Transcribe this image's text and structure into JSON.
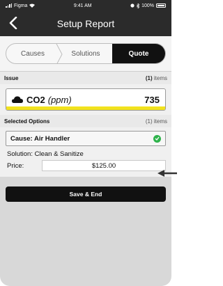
{
  "statusbar": {
    "carrier": "Figma",
    "time": "9:41 AM",
    "battery": "100%"
  },
  "navbar": {
    "title": "Setup Report",
    "back_icon": "chevron-left-icon"
  },
  "tabs": [
    {
      "label": "Causes",
      "active": false
    },
    {
      "label": "Solutions",
      "active": false
    },
    {
      "label": "Quote",
      "active": true
    }
  ],
  "issue_section": {
    "title": "Issue",
    "count": "(1)",
    "count_suffix": "items"
  },
  "issue": {
    "icon": "cloud-icon",
    "name": "CO2",
    "unit": "(ppm)",
    "value": "735",
    "status_color": "#f2e21d"
  },
  "options_section": {
    "title": "Selected Options",
    "count": "(1) items"
  },
  "option": {
    "cause": "Cause: Air Handler",
    "check_icon": "check-circle-icon",
    "solution": "Solution: Clean & Sanitize",
    "price_label": "Price:",
    "price_value": "$125.00"
  },
  "actions": {
    "save_label": "Save & End"
  },
  "colors": {
    "header_bg": "#2b2b2b",
    "active_tab": "#111111",
    "check": "#2fb34c"
  }
}
